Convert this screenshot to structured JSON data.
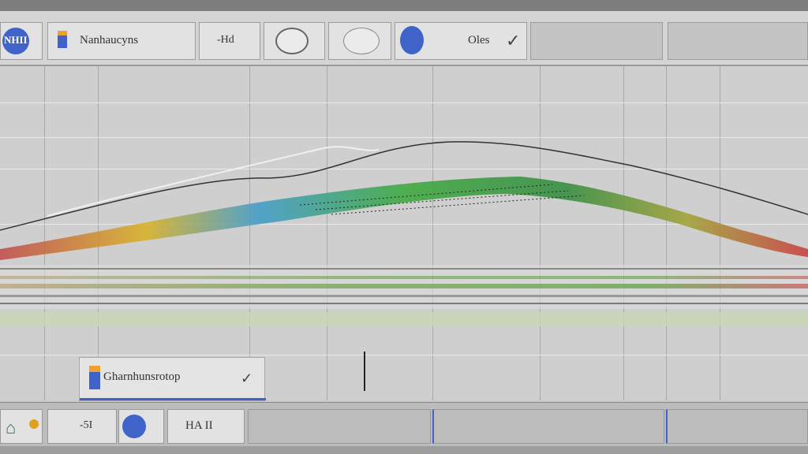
{
  "toolbar": {
    "app_label": "NHII",
    "title": "Nanhaucyns",
    "tool_1_label": "-Hd",
    "tool_4_label": "Oles",
    "colors": {
      "accent": "#3f63c8",
      "toolbar": "#d4d4d4",
      "panel": "#e4e4e4"
    }
  },
  "plot": {
    "legend_panel_label": "Gharnhunsrotop"
  },
  "bottombar": {
    "item_1_label": "-5I",
    "item_3_label": "HA II"
  },
  "icons": [
    "app-logo-icon",
    "document-icon",
    "ellipse-tool-icon",
    "globe-icon",
    "checkmark-icon",
    "home-icon"
  ]
}
